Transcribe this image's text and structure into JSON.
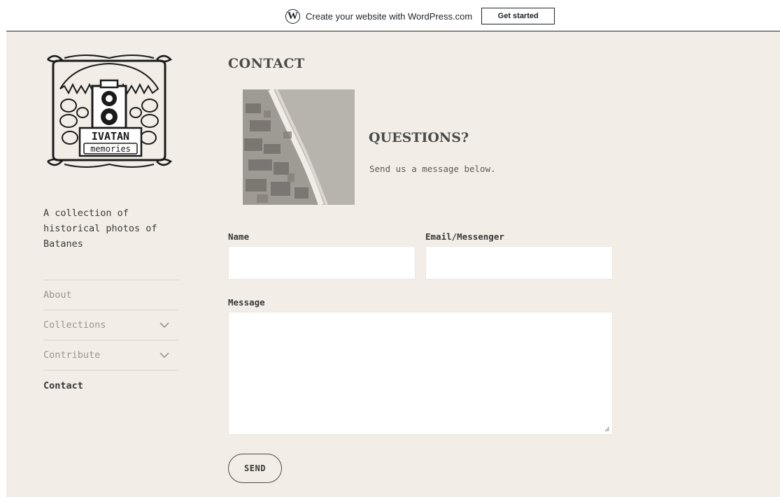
{
  "promo_bar": {
    "text": "Create your website with WordPress.com",
    "button_label": "Get started"
  },
  "site": {
    "logo_title": "IVATAN",
    "logo_subtitle": "memories",
    "tagline": "A collection of historical photos of Batanes"
  },
  "nav": {
    "items": [
      {
        "label": "About",
        "has_submenu": false,
        "current": false
      },
      {
        "label": "Collections",
        "has_submenu": true,
        "current": false
      },
      {
        "label": "Contribute",
        "has_submenu": true,
        "current": false
      },
      {
        "label": "Contact",
        "has_submenu": false,
        "current": true
      }
    ]
  },
  "main": {
    "page_title": "CONTACT",
    "heading": "QUESTIONS?",
    "subtext": "Send us a message below."
  },
  "form": {
    "name_label": "Name",
    "name_value": "",
    "email_label": "Email/Messenger",
    "email_value": "",
    "message_label": "Message",
    "message_value": "",
    "send_label": "SEND"
  },
  "icons": {
    "wordpress": "wordpress-logo-icon",
    "chevron": "chevron-down-icon",
    "resize": "resize-grip-icon"
  },
  "colors": {
    "background": "#f2eee7",
    "text": "#3a3a3a",
    "muted": "#9a958d",
    "field": "#ffffff"
  }
}
